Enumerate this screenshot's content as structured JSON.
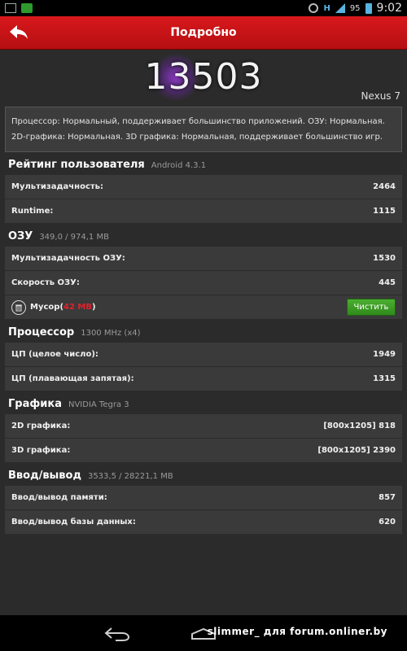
{
  "status_bar": {
    "battery": "95",
    "time": "9:02",
    "network": "H"
  },
  "header": {
    "title": "Подробно"
  },
  "score": {
    "value": "13503",
    "device": "Nexus 7"
  },
  "description": "Процессор: Нормальный, поддерживает большинство приложений. ОЗУ: Нормальная. 2D-графика: Нормальная. 3D графика: Нормальная, поддерживает большинство игр.",
  "sections": {
    "user": {
      "title": "Рейтинг пользователя",
      "sub": "Android 4.3.1",
      "rows": [
        {
          "label": "Мультизадачность:",
          "value": "2464"
        },
        {
          "label": "Runtime:",
          "value": "1115"
        }
      ]
    },
    "ram": {
      "title": "ОЗУ",
      "sub": "349,0 / 974,1 MB",
      "rows": [
        {
          "label": "Мультизадачность ОЗУ:",
          "value": "1530"
        },
        {
          "label": "Скорость ОЗУ:",
          "value": "445"
        }
      ],
      "junk": {
        "label": "Мусор",
        "size": "42 MB",
        "button": "Чистить"
      }
    },
    "cpu": {
      "title": "Процессор",
      "sub": "1300 MHz (x4)",
      "rows": [
        {
          "label": "ЦП (целое число):",
          "value": "1949"
        },
        {
          "label": "ЦП (плавающая запятая):",
          "value": "1315"
        }
      ]
    },
    "graphics": {
      "title": "Графика",
      "sub": "NVIDIA Tegra 3",
      "rows": [
        {
          "label": "2D графика:",
          "value": "[800x1205] 818"
        },
        {
          "label": "3D графика:",
          "value": "[800x1205] 2390"
        }
      ]
    },
    "io": {
      "title": "Ввод/вывод",
      "sub": "3533,5 / 28221,1 MB",
      "rows": [
        {
          "label": "Ввод/вывод памяти:",
          "value": "857"
        },
        {
          "label": "Ввод/вывод базы данных:",
          "value": "620"
        }
      ]
    }
  },
  "watermark": "slimmer_ для forum.onliner.by",
  "colors": {
    "header_red": "#c8141a",
    "accent_junk": "#e0212a",
    "button_green": "#3e9e26"
  }
}
